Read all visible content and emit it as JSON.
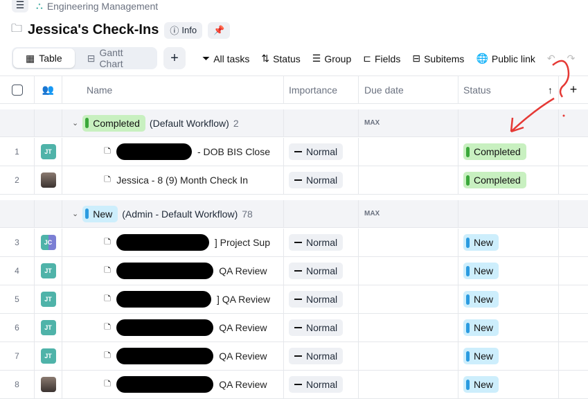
{
  "breadcrumb": "Engineering Management",
  "title": "Jessica's Check-Ins",
  "info_label": "Info",
  "views": {
    "table": "Table",
    "gantt": "Gantt Chart"
  },
  "toolbar": {
    "all_tasks": "All tasks",
    "status": "Status",
    "group": "Group",
    "fields": "Fields",
    "subitems": "Subitems",
    "public_link": "Public link"
  },
  "columns": {
    "name": "Name",
    "importance": "Importance",
    "due": "Due date",
    "status": "Status"
  },
  "colors": {
    "completed": "#c8f0c0",
    "completed_bar": "#3aa83a",
    "new": "#cdeefc",
    "new_bar": "#2b9be0"
  },
  "groups": [
    {
      "label": "Completed",
      "suffix": "(Default Workflow)",
      "count": "2",
      "max": "MAX",
      "rows": [
        {
          "num": "1",
          "avatar": "JT",
          "name": "- DOB BIS Close",
          "importance": "Normal",
          "status": "Completed"
        },
        {
          "num": "2",
          "avatar": "photo",
          "name": "Jessica - 8 (9) Month Check In",
          "importance": "Normal",
          "status": "Completed"
        }
      ]
    },
    {
      "label": "New",
      "suffix": "(Admin - Default Workflow)",
      "count": "78",
      "max": "MAX",
      "rows": [
        {
          "num": "3",
          "avatar": "JC",
          "name": "] Project Sup",
          "importance": "Normal",
          "status": "New"
        },
        {
          "num": "4",
          "avatar": "JT",
          "name": "QA Review",
          "importance": "Normal",
          "status": "New"
        },
        {
          "num": "5",
          "avatar": "JT",
          "name": "] QA Review",
          "importance": "Normal",
          "status": "New"
        },
        {
          "num": "6",
          "avatar": "JT",
          "name": "QA Review",
          "importance": "Normal",
          "status": "New"
        },
        {
          "num": "7",
          "avatar": "JT",
          "name": "QA Review",
          "importance": "Normal",
          "status": "New"
        },
        {
          "num": "8",
          "avatar": "photo",
          "name": "QA Review",
          "importance": "Normal",
          "status": "New"
        }
      ]
    }
  ]
}
